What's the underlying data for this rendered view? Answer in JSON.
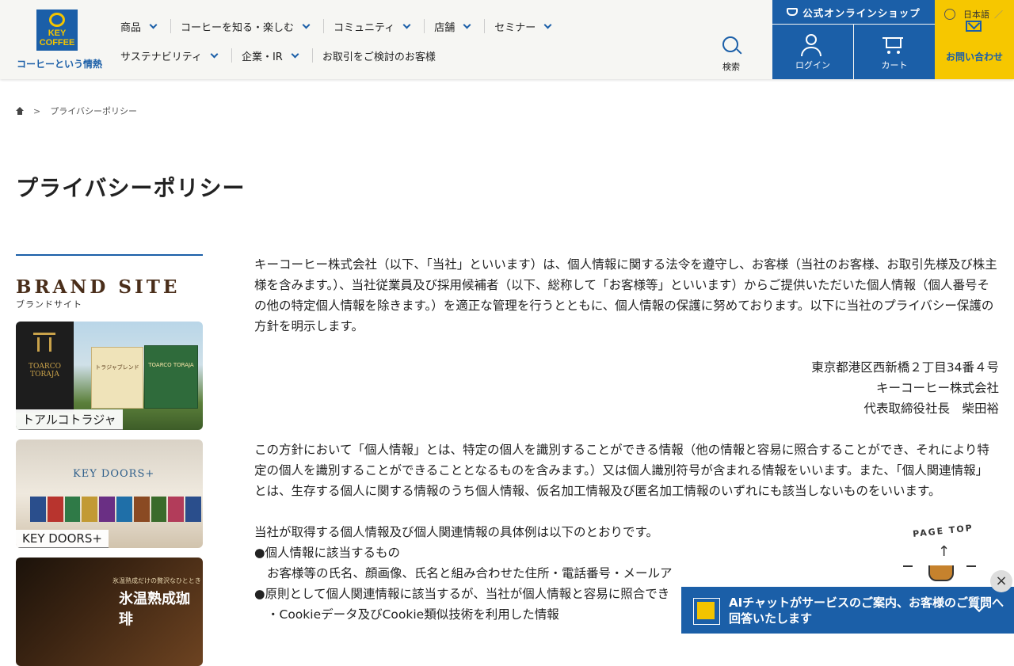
{
  "header": {
    "logo_text": "KEY COFFEE",
    "tagline": "コーヒーという情熱",
    "nav_row1": [
      "商品",
      "コーヒーを知る・楽しむ",
      "コミュニティ",
      "店舗",
      "セミナー"
    ],
    "nav_row2": [
      "サステナビリティ",
      "企業・IR",
      "お取引をご検討のお客様"
    ],
    "search_label": "検索",
    "shop_label": "公式オンラインショップ",
    "login_label": "ログイン",
    "cart_label": "カート",
    "language": "日本語",
    "contact_label": "お問い合わせ"
  },
  "breadcrumb": {
    "current": "プライバシーポリシー",
    "separator": ">"
  },
  "page_title": "プライバシーポリシー",
  "sidebar": {
    "brand_title": "BRAND SITE",
    "brand_subtitle": "ブランドサイト",
    "cards": [
      {
        "label": "トアルコトラジャ",
        "logo": "TOARCO TORAJA",
        "box_a": "トラジャブレンド",
        "box_b": "TOARCO TORAJA"
      },
      {
        "label": "KEY DOORS+",
        "title": "KEY DOORS+"
      },
      {
        "label": "",
        "title": "氷温熟成珈琲",
        "sub": "氷温熟成だけの贅沢なひととき"
      }
    ]
  },
  "content": {
    "p1": "キーコーヒー株式会社（以下、「当社」といいます）は、個人情報に関する法令を遵守し、お客様（当社のお客様、お取引先様及び株主様を含みます。）、当社従業員及び採用候補者（以下、総称して「お客様等」といいます）からご提供いただいた個人情報（個人番号その他の特定個人情報を除きます。）を適正な管理を行うとともに、個人情報の保護に努めております。以下に当社のプライバシー保護の方針を明示します。",
    "address": "東京都港区西新橋２丁目34番４号",
    "company": "キーコーヒー株式会社",
    "representative": "代表取締役社長　柴田裕",
    "p3": "この方針において「個人情報」とは、特定の個人を識別することができる情報（他の情報と容易に照合することができ、それにより特定の個人を識別することができることとなるものを含みます。）又は個人識別符号が含まれる情報をいいます。また、「個人関連情報」とは、生存する個人に関する情報のうち個人情報、仮名加工情報及び匿名加工情報のいずれにも該当しないものをいいます。",
    "p4": "当社が取得する個人情報及び個人関連情報の具体例は以下のとおりです。",
    "b1": "●個人情報に該当するもの",
    "b1_detail": "お客様等の氏名、顔画像、氏名と組み合わせた住所・電話番号・メールア",
    "b2": "●原則として個人関連情報に該当するが、当社が個人情報と容易に照合でき",
    "b2_detail": "・Cookieデータ及びCookie類似技術を利用した情報"
  },
  "page_top": "PAGE TOP",
  "chat": {
    "text": "AIチャットがサービスのご案内、お客様のご質問へ回答いたします",
    "close": "×"
  }
}
